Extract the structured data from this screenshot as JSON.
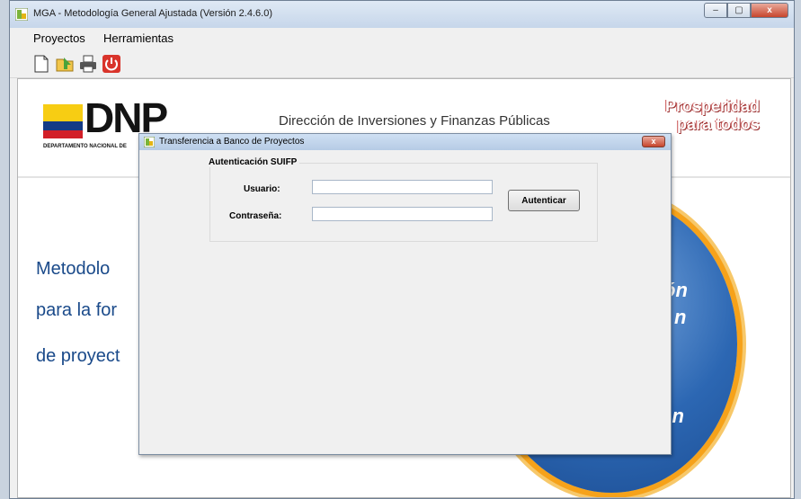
{
  "window": {
    "title": "MGA - Metodología General Ajustada (Versión 2.4.6.0)",
    "controls": {
      "minimize": "–",
      "maximize": "▢",
      "close": "x"
    }
  },
  "menu": {
    "items": [
      {
        "label": "Proyectos"
      },
      {
        "label": "Herramientas"
      }
    ]
  },
  "toolbar": {
    "tools": [
      {
        "icon": "new-document-icon"
      },
      {
        "icon": "open-folder-icon"
      },
      {
        "icon": "print-icon"
      },
      {
        "icon": "power-exit-icon"
      }
    ]
  },
  "banner": {
    "logo_text": "DNP",
    "logo_subtitle": "DEPARTAMENTO NACIONAL DE",
    "directorate": "Dirección de Inversiones y Finanzas Públicas",
    "slogan_line1": "Prosperidad",
    "slogan_line2": "para todos"
  },
  "background_text": {
    "line1": "Metodolo",
    "line2": "para la for",
    "line3": "de proyect",
    "circle_line1": "ón",
    "circle_line2": "n",
    "circle_line3": "ión"
  },
  "dialog": {
    "title": "Transferencia a Banco de Proyectos",
    "close_label": "x",
    "group_label": "Autenticación SUIFP",
    "user_label": "Usuario:",
    "user_value": "",
    "password_label": "Contraseña:",
    "password_value": "",
    "auth_button": "Autenticar"
  },
  "colors": {
    "titlebar": "#c6d6ea",
    "flag_yellow": "#f7cd13",
    "flag_blue": "#133b86",
    "flag_red": "#d21f28",
    "circle_blue": "#2c67b3",
    "circle_ring": "#f6a21a",
    "heading_blue": "#1a4a8a"
  }
}
